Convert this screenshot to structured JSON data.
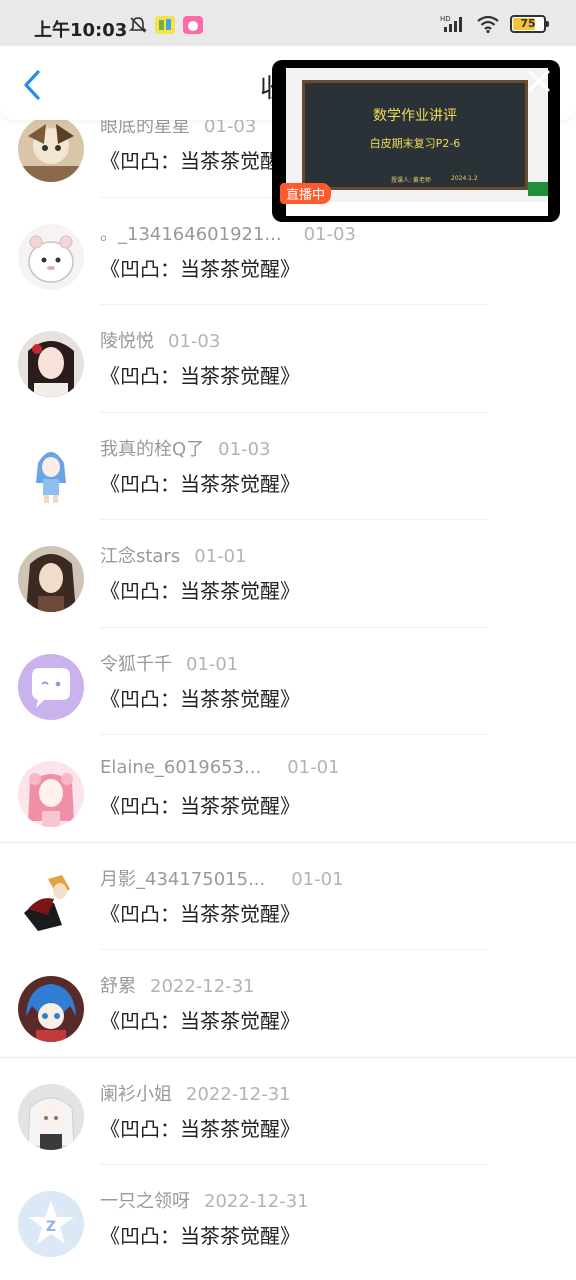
{
  "status_bar": {
    "time": "上午10:03",
    "battery": "75",
    "battery_level": 0.75,
    "left_icons": [
      "mute-bell-icon",
      "app-notification-icon",
      "app-notification-icon"
    ],
    "right_icons": [
      "hd-signal-icon",
      "wifi-icon",
      "battery-icon"
    ]
  },
  "header": {
    "title": "收",
    "back_icon": "chevron-left-icon"
  },
  "live_window": {
    "board_title": "数学作业讲评",
    "board_subtitle": "白皮期末复习P2-6",
    "board_footer_left": "授课人: 黄老师",
    "board_footer_right": "2024.1.2",
    "badge": "直播中",
    "close_icon": "close-icon"
  },
  "list": {
    "items": [
      {
        "name": "眼底的星星",
        "date": "01-03",
        "title": "《凹凸：当茶茶觉醒》"
      },
      {
        "name": "。_134164601921...",
        "date": "01-03",
        "title": "《凹凸：当茶茶觉醒》"
      },
      {
        "name": "陵悦悦",
        "date": "01-03",
        "title": "《凹凸：当茶茶觉醒》"
      },
      {
        "name": "我真的栓Q了",
        "date": "01-03",
        "title": "《凹凸：当茶茶觉醒》"
      },
      {
        "name": "江念stars",
        "date": "01-01",
        "title": "《凹凸：当茶茶觉醒》"
      },
      {
        "name": "令狐千千",
        "date": "01-01",
        "title": "《凹凸：当茶茶觉醒》"
      },
      {
        "name": "Elaine_6019653...",
        "date": "01-01",
        "title": "《凹凸：当茶茶觉醒》"
      },
      {
        "name": "月影_434175015...",
        "date": "01-01",
        "title": "《凹凸：当茶茶觉醒》"
      },
      {
        "name": "舒累",
        "date": "2022-12-31",
        "title": "《凹凸：当茶茶觉醒》"
      },
      {
        "name": "阑衫小姐",
        "date": "2022-12-31",
        "title": "《凹凸：当茶茶觉醒》"
      },
      {
        "name": "一只之领呀",
        "date": "2022-12-31",
        "title": "《凹凸：当茶茶觉醒》"
      }
    ]
  },
  "colors": {
    "accent": "#2a8be8",
    "live_badge": "#ff5a2c",
    "name_text": "#999999",
    "title_text": "#222222"
  }
}
